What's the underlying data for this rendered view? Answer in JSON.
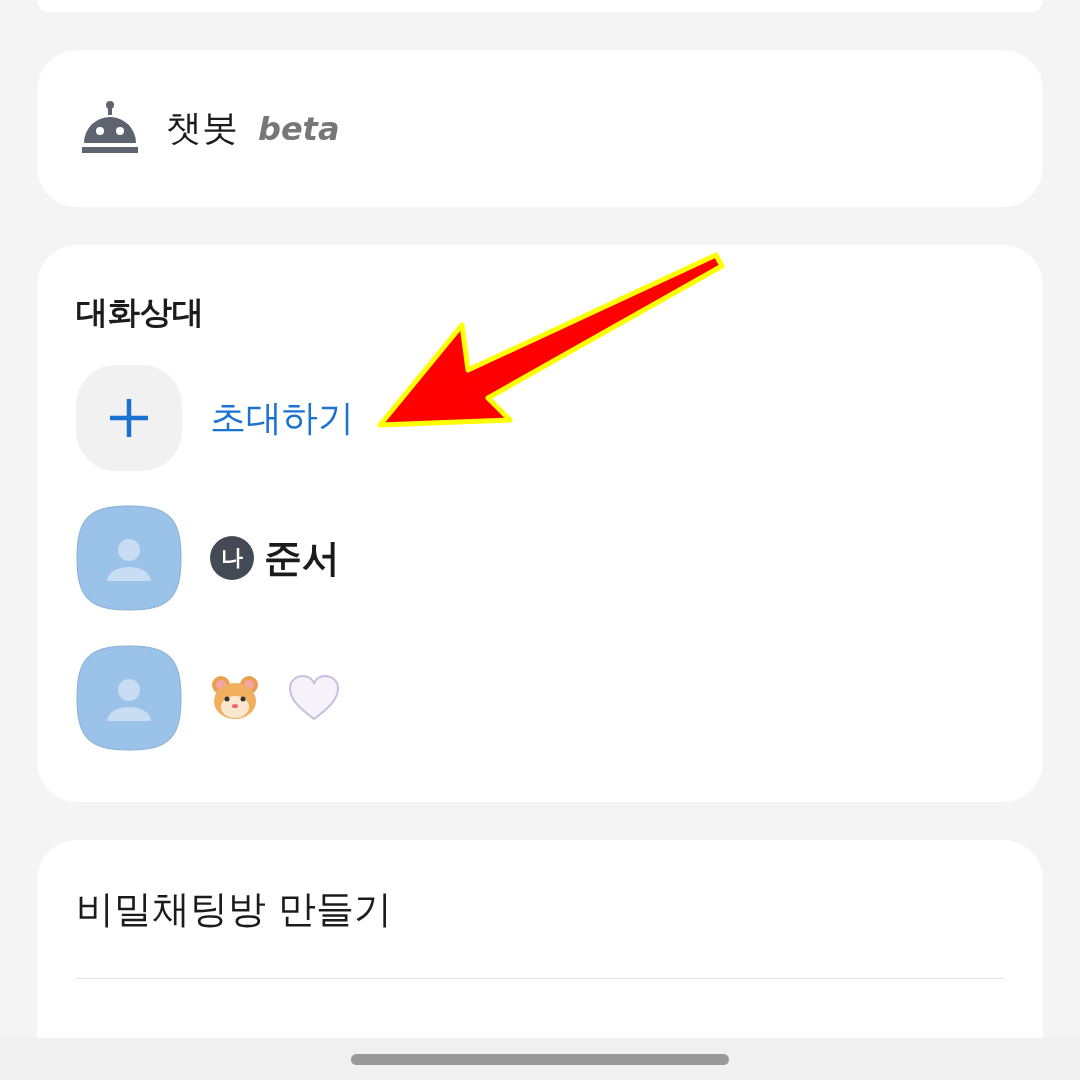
{
  "chatbot": {
    "label": "챗봇",
    "badge": "beta"
  },
  "participants": {
    "heading": "대화상대",
    "invite": {
      "label": "초대하기"
    },
    "members": [
      {
        "kind": "me",
        "badge": "나",
        "name": "준서"
      },
      {
        "kind": "emoji_name"
      }
    ]
  },
  "actions": [
    {
      "label": "비밀채팅방 만들기"
    }
  ]
}
